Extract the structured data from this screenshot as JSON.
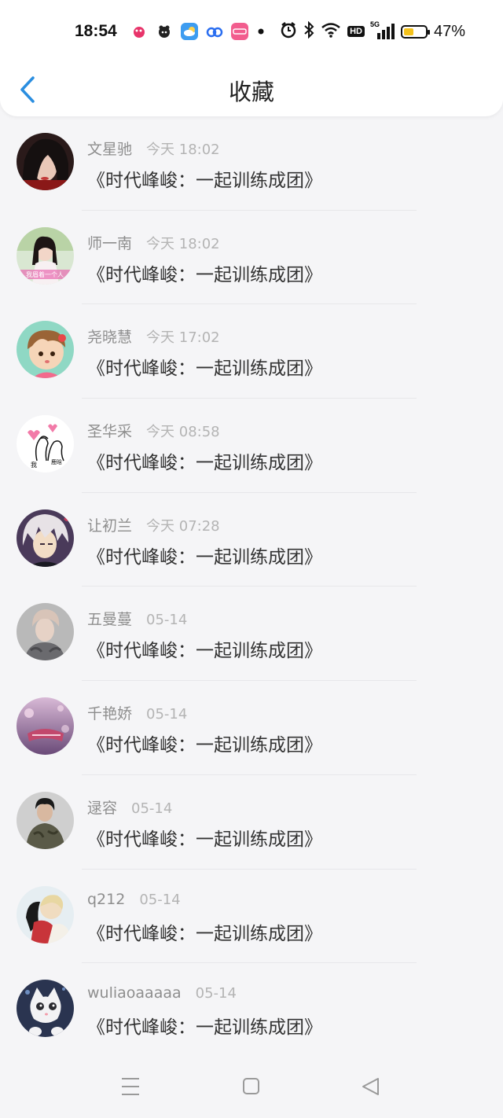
{
  "status_bar": {
    "time": "18:54",
    "battery_percent": "47%",
    "battery_level": 0.47,
    "network": "5G",
    "hd_badge": "HD",
    "icons": [
      "app-icon-1",
      "app-icon-2",
      "weather-app-icon",
      "cloud-app-icon",
      "lolly-app-icon",
      "dot-icon",
      "alarm-icon",
      "bluetooth-icon",
      "wifi-icon",
      "hd-icon",
      "signal-5g-icon",
      "battery-icon"
    ]
  },
  "header": {
    "back_icon": "chevron-left-icon",
    "title": "收藏"
  },
  "colors": {
    "accent": "#2a8ee0",
    "name": "#8e8e8e",
    "time": "#b4b4b4",
    "title": "#333333",
    "background": "#f5f5f7"
  },
  "favorites": [
    {
      "name": "文星驰",
      "time": "今天 18:02",
      "title": "《时代峰峻：一起训练成团》"
    },
    {
      "name": "师一南",
      "time": "今天 18:02",
      "title": "《时代峰峻：一起训练成团》"
    },
    {
      "name": "尧晓慧",
      "time": "今天 17:02",
      "title": "《时代峰峻：一起训练成团》"
    },
    {
      "name": "圣华采",
      "time": "今天 08:58",
      "title": "《时代峰峻：一起训练成团》"
    },
    {
      "name": "让初兰",
      "time": "今天 07:28",
      "title": "《时代峰峻：一起训练成团》"
    },
    {
      "name": "五曼蔓",
      "time": "05-14",
      "title": "《时代峰峻：一起训练成团》"
    },
    {
      "name": "千艳娇",
      "time": "05-14",
      "title": "《时代峰峻：一起训练成团》"
    },
    {
      "name": "逯容",
      "time": "05-14",
      "title": "《时代峰峻：一起训练成团》"
    },
    {
      "name": "q212",
      "time": "05-14",
      "title": "《时代峰峻：一起训练成团》"
    },
    {
      "name": "wuliaoaaaaa",
      "time": "05-14",
      "title": "《时代峰峻：一起训练成团》"
    }
  ],
  "avatar_text": {
    "a2": "我眉着一个人",
    "a4_left": "我",
    "a4_right": "鹿晗"
  },
  "bottom_nav": [
    "menu-icon",
    "home-icon",
    "back-triangle-icon"
  ]
}
